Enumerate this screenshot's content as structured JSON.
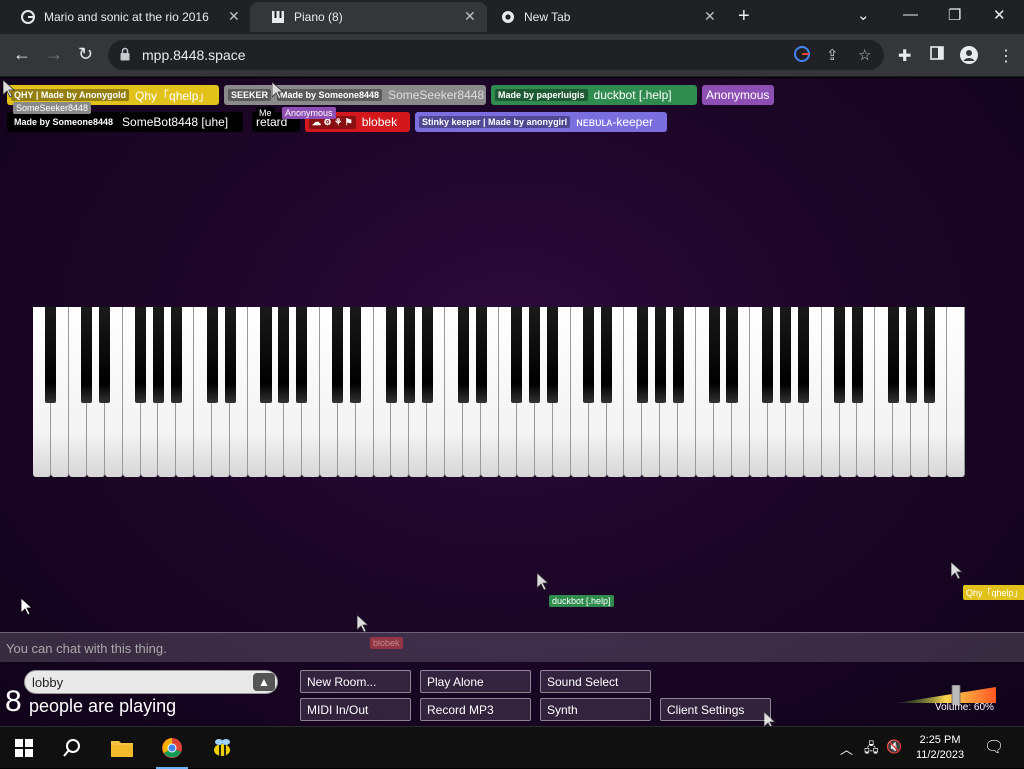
{
  "browser": {
    "tabs": [
      {
        "title": "Mario and sonic at the rio 2016",
        "icon": "google-icon",
        "active": false
      },
      {
        "title": "Piano (8)",
        "icon": "piano-icon",
        "active": true
      },
      {
        "title": "New Tab",
        "icon": "chrome-icon",
        "active": false
      }
    ],
    "url": "mpp.8448.space"
  },
  "players_row1": [
    {
      "sub": "QHY | Made by Anonygold",
      "name": "Qhy「qhelp」",
      "color": "#e2c21a"
    },
    {
      "sub": "SEEKER",
      "sub2": "Made by Someone8448",
      "name": "SomeSeeker8448",
      "color": "#8a8a8a"
    },
    {
      "sub": "Made by paperluigis",
      "name": "duckbot [.help]",
      "color": "#2f8c4e"
    },
    {
      "name": "Anonymous",
      "color": "#8e4fb5"
    }
  ],
  "players_row2": [
    {
      "sub": "Made by Someone8448",
      "name": "SomeBot8448 [uhe]",
      "color": "#000000"
    },
    {
      "name": "retard",
      "color": "#000000"
    },
    {
      "sub": "☁ ⚙ ⚘ ⚑",
      "name": "blobek",
      "color": "#d2181c"
    },
    {
      "sub": "Stinky keeper | Made by anonygirl",
      "name": "ɴᴇʙᴜʟᴀ-keeper",
      "color": "#7b6fe0"
    }
  ],
  "cursor_labels": {
    "someseeker": "SomeSeeker8448",
    "me": "Me",
    "anonymous": "Anonymous",
    "duckbot": "duckbot [.help]",
    "qhy": "Qhy「qhelp」",
    "blobek": "blobek"
  },
  "chat": {
    "placeholder": "You can chat with this thing."
  },
  "room": {
    "name": "lobby",
    "arrow": "▲"
  },
  "people": {
    "count": "8",
    "label": "people are playing"
  },
  "buttons": {
    "new_room": "New Room...",
    "play_alone": "Play Alone",
    "sound_select": "Sound Select",
    "midi": "MIDI In/Out",
    "record": "Record MP3",
    "synth": "Synth",
    "client_settings": "Client Settings"
  },
  "volume": {
    "label": "Volume: 60%",
    "value": 0.6
  },
  "taskbar": {
    "time": "2:25 PM",
    "date": "11/2/2023"
  }
}
